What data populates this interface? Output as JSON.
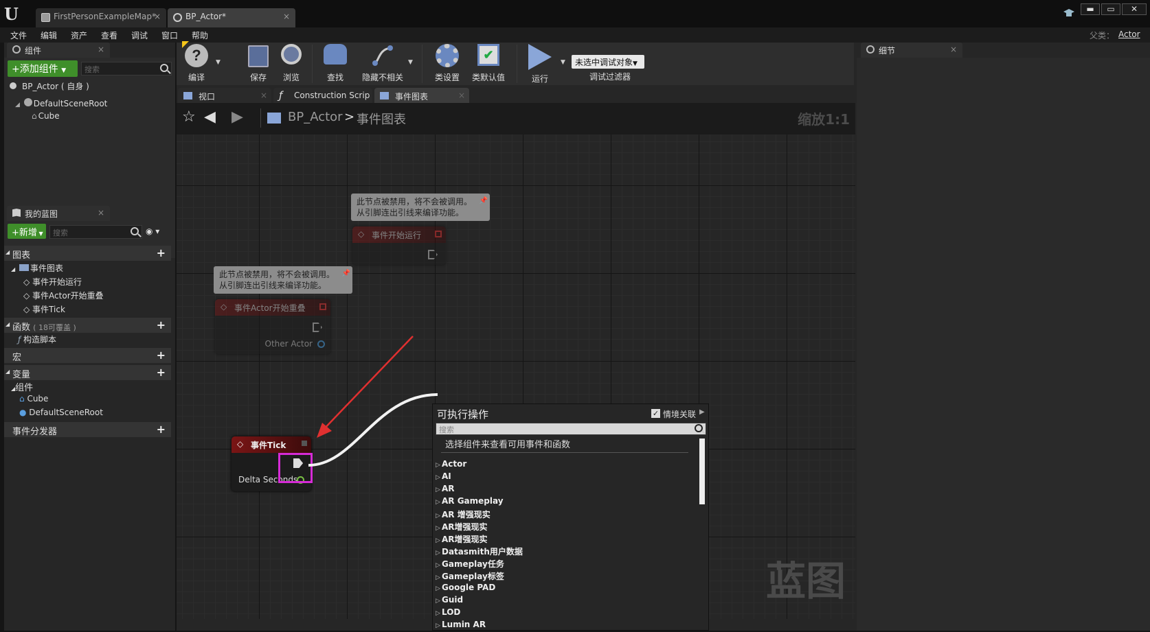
{
  "titlebar": {
    "logo": "U",
    "tabs": [
      {
        "label": "FirstPersonExampleMap*",
        "close": "×"
      },
      {
        "label": "BP_Actor*",
        "close": "×"
      }
    ],
    "win_min": "▬",
    "win_max": "▭",
    "win_close": "✕"
  },
  "menubar": {
    "items": [
      "文件",
      "编辑",
      "资产",
      "查看",
      "调试",
      "窗口",
      "帮助"
    ],
    "parent_label": "父类：",
    "parent_value": "Actor"
  },
  "components_panel": {
    "tab": "组件",
    "add_button": "+添加组件",
    "search_placeholder": "搜索",
    "self_item": "BP_Actor ( 自身 )",
    "root": "DefaultSceneRoot",
    "child": "Cube"
  },
  "my_blueprint": {
    "tab": "我的蓝图",
    "new_button": "+新增",
    "search_placeholder": "搜索",
    "graphs_label": "图表",
    "event_graph": "事件图表",
    "events": [
      "事件开始运行",
      "事件Actor开始重叠",
      "事件Tick"
    ],
    "functions_label": "函数",
    "functions_override": "( 18可覆盖 )",
    "construction_script": "构造脚本",
    "macros_label": "宏",
    "variables_label": "变量",
    "components_label": "组件",
    "component_items": [
      "Cube",
      "DefaultSceneRoot"
    ],
    "dispatchers_label": "事件分发器"
  },
  "toolbar": {
    "compile": "编译",
    "save": "保存",
    "browse": "浏览",
    "find": "查找",
    "hide_unrelated": "隐藏不相关",
    "class_settings": "类设置",
    "class_defaults": "类默认值",
    "play": "运行",
    "debug_select": "未选中调试对象",
    "debug_filter": "调试过滤器"
  },
  "editor_tabs": {
    "viewport": "视口",
    "construction": "Construction Scrip",
    "event_graph": "事件图表"
  },
  "graph": {
    "breadcrumb_root": "BP_Actor",
    "breadcrumb_sep": ">",
    "breadcrumb_current": "事件图表",
    "zoom": "缩放1:1",
    "watermark": "蓝图",
    "comment_line1": "此节点被禁用，将不会被调用。",
    "comment_line2": "从引脚连出引线来编译功能。",
    "node_begin_play": "事件开始运行",
    "node_overlap": "事件Actor开始重叠",
    "overlap_pin": "Other Actor",
    "node_tick": "事件Tick",
    "tick_pin": "Delta Seconds",
    "highlight_color": "#d62bd6",
    "arrow_color": "#e03030"
  },
  "context_menu": {
    "title": "可执行操作",
    "context_sensitive": "情境关联",
    "search_placeholder": "搜索",
    "hint": "选择组件来查看可用事件和函数",
    "categories": [
      "Actor",
      "AI",
      "AR",
      "AR Gameplay",
      "AR 增强现实",
      "AR增强现实",
      "AR增强现实",
      "Datasmith用户数据",
      "Gameplay任务",
      "Gameplay标签",
      "Google PAD",
      "Guid",
      "LOD",
      "Lumin AR"
    ]
  },
  "details_panel": {
    "tab": "细节"
  }
}
